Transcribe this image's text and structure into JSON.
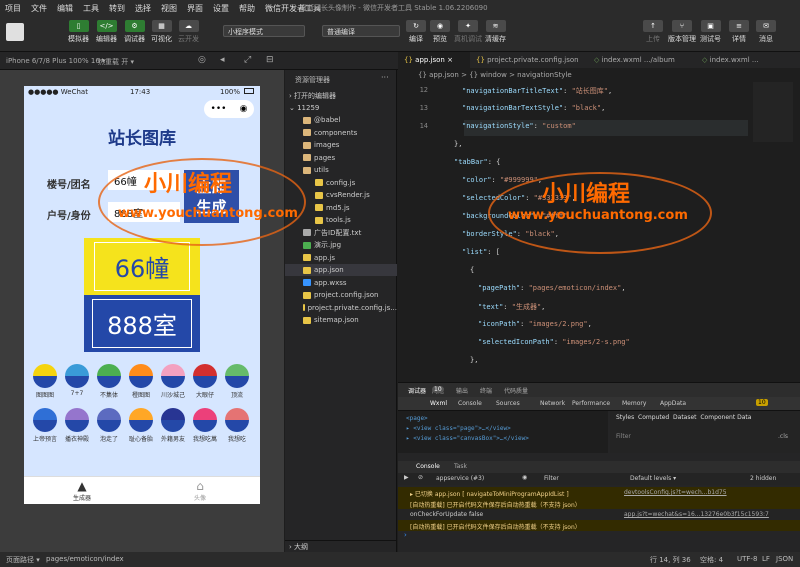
{
  "menu": [
    "项目",
    "文件",
    "编辑",
    "工具",
    "转到",
    "选择",
    "视图",
    "界面",
    "设置",
    "帮助",
    "微信开发者工具"
  ],
  "app_title": "魔断团长头像制作 - 微信开发者工具 Stable 1.06.2206090",
  "toolbar": {
    "simulator": "模拟器",
    "editor": "编辑器",
    "debugger": "调试器",
    "visual": "可视化",
    "cloud": "云开发",
    "mode": "小程序模式",
    "compile_mode": "普通编译",
    "compile": "编译",
    "preview": "预览",
    "real_debug": "真机调试",
    "clear_cache": "清缓存",
    "upload": "上传",
    "version": "版本管理",
    "test": "测试号",
    "detail": "详情",
    "message": "消息"
  },
  "device": {
    "model": "iPhone 6/7/8 Plus 100% 16 ▾",
    "hot_reload": "热重载 开 ▾"
  },
  "phone": {
    "carrier": "●●●●● WeChat",
    "time": "17:43",
    "battery": "100%",
    "title": "站长图库",
    "label_building": "楼号/团名",
    "value_building": "66幢",
    "label_room": "户号/身份",
    "value_room": "888室",
    "generate": "立即\n生成",
    "preview_top": "66幢",
    "preview_bottom": "888室",
    "colors_row1": [
      {
        "c": "#f5d40e",
        "label": "图图图"
      },
      {
        "c": "#3a9bd8",
        "label": "7+7"
      },
      {
        "c": "#4caf50",
        "label": "不集体"
      },
      {
        "c": "#ff8c1a",
        "label": "橙图图"
      },
      {
        "c": "#f3a1c0",
        "label": "川沙城己"
      },
      {
        "c": "#d32f2f",
        "label": "大眼仔"
      },
      {
        "c": "#66bb6a",
        "label": "顶流"
      }
    ],
    "colors_row2": [
      {
        "c": "#2f6fd6",
        "label": "上帝预言"
      },
      {
        "c": "#9575cd",
        "label": "播衣神殿"
      },
      {
        "c": "#5c6bc0",
        "label": "泡走了"
      },
      {
        "c": "#ffa726",
        "label": "耻心备胎"
      },
      {
        "c": "#283593",
        "label": "外籍男友"
      },
      {
        "c": "#ec407a",
        "label": "我想吃萬"
      },
      {
        "c": "#e57373",
        "label": "我想吃"
      }
    ],
    "nav_home": "生成器",
    "nav_head": "头像"
  },
  "explorer": {
    "title": "资源管理器",
    "open_editors": "打开的编辑器",
    "project": "11259",
    "files": [
      {
        "name": "@babel",
        "type": "folder",
        "depth": 1
      },
      {
        "name": "components",
        "type": "folder",
        "depth": 1
      },
      {
        "name": "images",
        "type": "folder",
        "depth": 1
      },
      {
        "name": "pages",
        "type": "folder",
        "depth": 1
      },
      {
        "name": "utils",
        "type": "folder",
        "depth": 1
      },
      {
        "name": "config.js",
        "type": "js",
        "depth": 2
      },
      {
        "name": "cvsRender.js",
        "type": "js",
        "depth": 2
      },
      {
        "name": "md5.js",
        "type": "js",
        "depth": 2
      },
      {
        "name": "tools.js",
        "type": "js",
        "depth": 2
      },
      {
        "name": "广告ID配置.txt",
        "type": "txt",
        "depth": 1
      },
      {
        "name": "演示.jpg",
        "type": "img",
        "depth": 1
      },
      {
        "name": "app.js",
        "type": "js",
        "depth": 1
      },
      {
        "name": "app.json",
        "type": "json",
        "depth": 1
      },
      {
        "name": "app.wxss",
        "type": "wxss",
        "depth": 1
      },
      {
        "name": "project.config.json",
        "type": "json",
        "depth": 1
      },
      {
        "name": "project.private.config.js...",
        "type": "json",
        "depth": 1
      },
      {
        "name": "sitemap.json",
        "type": "json",
        "depth": 1
      }
    ],
    "outline": "大纲"
  },
  "tabs": [
    "app.json",
    "project.private.config.json",
    "index.wxml .../album",
    "index.wxml ..."
  ],
  "breadcrumb": "{} app.json > {} window > navigationStyle",
  "code": [
    {
      "n": "12",
      "t": [
        [
          "k",
          "\"navigationBarTitleText\""
        ],
        [
          "p",
          ": "
        ],
        [
          "s",
          "\"站长图库\""
        ],
        [
          "p",
          ","
        ]
      ]
    },
    {
      "n": "13",
      "t": [
        [
          "k",
          "\"navigationBarTextStyle\""
        ],
        [
          "p",
          ": "
        ],
        [
          "s",
          "\"black\""
        ],
        [
          "p",
          ","
        ]
      ]
    },
    {
      "n": "14",
      "t": [
        [
          "k",
          "\"navigationStyle\""
        ],
        [
          "p",
          ": "
        ],
        [
          "s",
          "\"custom\""
        ]
      ]
    },
    {
      "n": "",
      "t": [
        [
          "p",
          "},"
        ]
      ]
    },
    {
      "n": "",
      "t": [
        [
          "k",
          "\"tabBar\""
        ],
        [
          "p",
          ": {"
        ]
      ]
    },
    {
      "n": "",
      "t": [
        [
          "k",
          "\"color\""
        ],
        [
          "p",
          ": "
        ],
        [
          "s",
          "\"#999999\""
        ],
        [
          "p",
          ","
        ]
      ]
    },
    {
      "n": "",
      "t": [
        [
          "k",
          "\"selectedColor\""
        ],
        [
          "p",
          ": "
        ],
        [
          "s",
          "\"#333333\""
        ],
        [
          "p",
          ","
        ]
      ]
    },
    {
      "n": "",
      "t": [
        [
          "k",
          "\"backgroundColor\""
        ],
        [
          "p",
          ": "
        ],
        [
          "s",
          "\"#fff\""
        ],
        [
          "p",
          ","
        ]
      ]
    },
    {
      "n": "",
      "t": [
        [
          "k",
          "\"borderStyle\""
        ],
        [
          "p",
          ": "
        ],
        [
          "s",
          "\"black\""
        ],
        [
          "p",
          ","
        ]
      ]
    },
    {
      "n": "",
      "t": [
        [
          "k",
          "\"list\""
        ],
        [
          "p",
          ": ["
        ]
      ]
    },
    {
      "n": "",
      "t": [
        [
          "p",
          "{"
        ]
      ]
    },
    {
      "n": "",
      "t": [
        [
          "k",
          "\"pagePath\""
        ],
        [
          "p",
          ": "
        ],
        [
          "s",
          "\"pages/emoticon/index\""
        ],
        [
          "p",
          ","
        ]
      ]
    },
    {
      "n": "",
      "t": [
        [
          "k",
          "\"text\""
        ],
        [
          "p",
          ": "
        ],
        [
          "s",
          "\"生成器\""
        ],
        [
          "p",
          ","
        ]
      ]
    },
    {
      "n": "",
      "t": [
        [
          "k",
          "\"iconPath\""
        ],
        [
          "p",
          ": "
        ],
        [
          "s",
          "\"images/2.png\""
        ],
        [
          "p",
          ","
        ]
      ]
    },
    {
      "n": "",
      "t": [
        [
          "k",
          "\"selectedIconPath\""
        ],
        [
          "p",
          ": "
        ],
        [
          "s",
          "\"images/2-s.png\""
        ]
      ]
    },
    {
      "n": "",
      "t": [
        [
          "p",
          "},"
        ]
      ]
    }
  ],
  "devtools": {
    "tabs": [
      "调试器",
      "问题",
      "输出",
      "终端",
      "代码质量"
    ],
    "badge": "10",
    "panels": [
      "Wxml",
      "Console",
      "Sources",
      "Network",
      "Performance",
      "Memory",
      "AppData"
    ],
    "warn_count": "10",
    "dom": [
      "<page>",
      "▸ <view class=\"page\">…</view>",
      "▸ <view class=\"canvasBox\">…</view>"
    ],
    "styles_tabs": [
      "Styles",
      "Computed",
      "Dataset",
      "Component Data"
    ],
    "filter": "Filter",
    "cls": ".cls",
    "console_tabs": [
      "Console",
      "Task"
    ],
    "context": "appservice (#3)",
    "filter2": "Filter",
    "levels": "Default levels ▾",
    "hidden": "2 hidden",
    "logs": [
      {
        "text": "▸ 已切换 app.json [ navigateToMiniProgramAppIdList ]",
        "src": "devtoolsConfig.js?t=wech...b1d75",
        "warn": true
      },
      {
        "text": "[自动热重载] 已开启代码文件保存后自动热重载（不支持 json）",
        "src": "",
        "warn": true
      },
      {
        "text": "onCheckForUpdate  false",
        "src": "app.js?t=wechat&s=16...13276e0b3f15c1593:7",
        "warn": false
      },
      {
        "text": "[自动热重载] 已开启代码文件保存后自动热重载（不支持 json）",
        "src": "",
        "warn": true
      }
    ]
  },
  "status": {
    "path_label": "页面路径 ▾",
    "path": "pages/emoticon/index",
    "position": "行 14, 列 36",
    "spaces": "空格: 4",
    "encoding": "UTF-8",
    "eol": "LF",
    "lang": "JSON"
  },
  "watermark": {
    "cn": "小川编程",
    "url": "www.youchuantong.com"
  }
}
